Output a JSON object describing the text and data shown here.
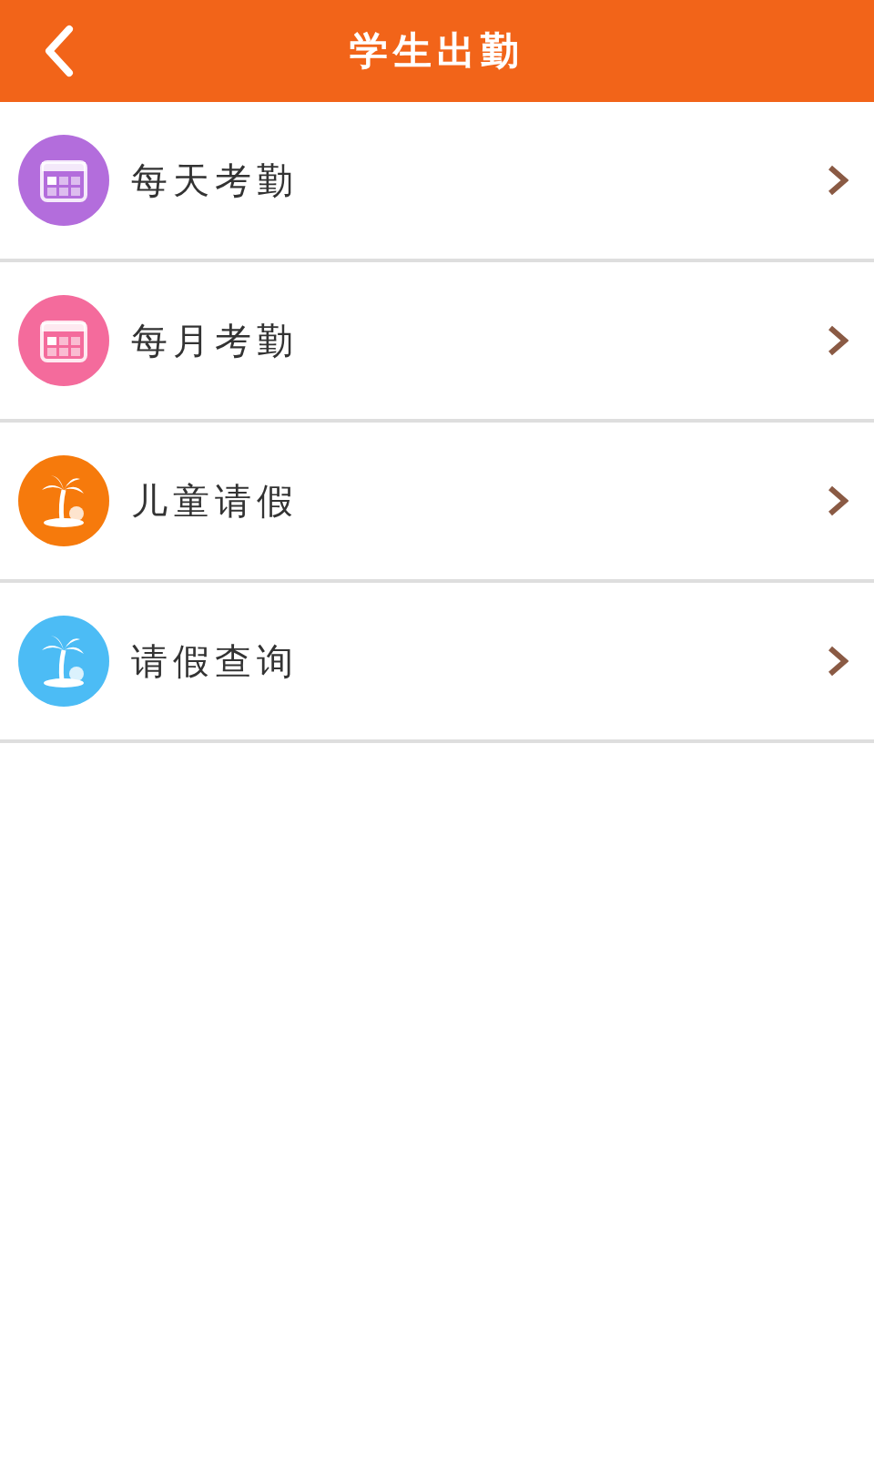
{
  "header": {
    "title": "学生出勤"
  },
  "items": [
    {
      "label": "每天考勤",
      "kind": "calendar",
      "color": "#b36ddc"
    },
    {
      "label": "每月考勤",
      "kind": "calendar",
      "color": "#f46b9c"
    },
    {
      "label": "儿童请假",
      "kind": "palm",
      "color": "#f67a0c"
    },
    {
      "label": "请假查询",
      "kind": "palm",
      "color": "#4cbcf5"
    }
  ]
}
